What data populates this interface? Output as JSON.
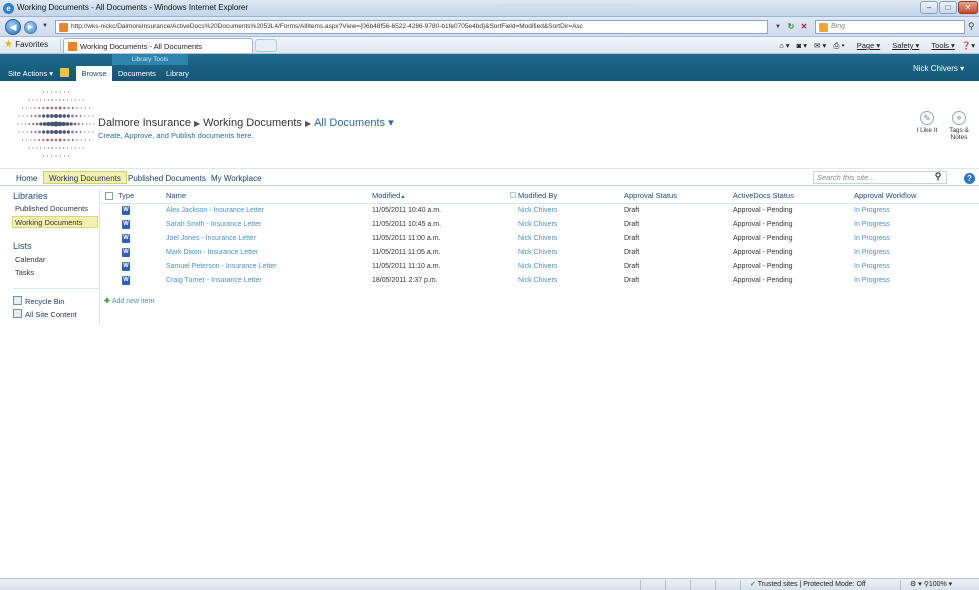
{
  "browser": {
    "window_title": "Working Documents - All Documents - Windows Internet Explorer",
    "url": "http://wks-nickc/DalmoreInsurance/ActiveDocs%20Documents%2053L4/Forms/AllItems.aspx?View={06b48f56-6522-4286-9780-b1fe0705e4bd}&SortField=Modified&SortDir=Asc",
    "search_placeholder": "Bing",
    "favorites_label": "Favorites",
    "tab_title": "Working Documents - All Documents",
    "commands": {
      "page": "Page",
      "safety": "Safety",
      "tools": "Tools"
    },
    "status_zone": "Trusted sites | Protected Mode: Off",
    "zoom": "100%"
  },
  "ribbon": {
    "tools_label": "Library Tools",
    "site_actions": "Site Actions",
    "tabs": {
      "browse": "Browse",
      "documents": "Documents",
      "library": "Library"
    },
    "user": "Nick Chivers"
  },
  "header": {
    "site": "Dalmore Insurance",
    "library": "Working Documents",
    "view": "All Documents",
    "description": "Create, Approve, and Publish documents here.",
    "i_like_it": "I Like It",
    "tags_notes_line1": "Tags &",
    "tags_notes_line2": "Notes"
  },
  "topnav": {
    "home": "Home",
    "working": "Working Documents",
    "published": "Published Documents",
    "workplace": "My Workplace",
    "search_placeholder": "Search this site..."
  },
  "quicklaunch": {
    "libraries_heading": "Libraries",
    "libraries": [
      "Published Documents",
      "Working Documents"
    ],
    "lists_heading": "Lists",
    "lists": [
      "Calendar",
      "Tasks"
    ],
    "recycle_bin": "Recycle Bin",
    "all_site_content": "All Site Content"
  },
  "doclist": {
    "columns": {
      "type": "Type",
      "name": "Name",
      "modified": "Modified",
      "modified_by": "Modified By",
      "approval_status": "Approval Status",
      "activedocs_status": "ActiveDocs Status",
      "approval_workflow": "Approval Workflow"
    },
    "rows": [
      {
        "name": "Alex Jackson - Insurance Letter",
        "modified": "11/05/2011 10:40 a.m.",
        "modified_by": "Nick Chivers",
        "approval": "Draft",
        "activedocs": "Approval - Pending",
        "workflow": "In Progress"
      },
      {
        "name": "Sarah Smith - Insurance Letter",
        "modified": "11/05/2011 10:45 a.m.",
        "modified_by": "Nick Chivers",
        "approval": "Draft",
        "activedocs": "Approval - Pending",
        "workflow": "In Progress"
      },
      {
        "name": "Joel Jones - Insurance Letter",
        "modified": "11/05/2011 11:00 a.m.",
        "modified_by": "Nick Chivers",
        "approval": "Draft",
        "activedocs": "Approval - Pending",
        "workflow": "In Progress"
      },
      {
        "name": "Mark Dixon - Insurance Letter",
        "modified": "11/05/2011 11:05 a.m.",
        "modified_by": "Nick Chivers",
        "approval": "Draft",
        "activedocs": "Approval - Pending",
        "workflow": "In Progress"
      },
      {
        "name": "Samuel Peterson - Insurance Letter",
        "modified": "11/05/2011 11:10 a.m.",
        "modified_by": "Nick Chivers",
        "approval": "Draft",
        "activedocs": "Approval - Pending",
        "workflow": "In Progress"
      },
      {
        "name": "Craig Turner - Insurance Letter",
        "modified": "18/05/2011 2:37 p.m.",
        "modified_by": "Nick Chivers",
        "approval": "Draft",
        "activedocs": "Approval - Pending",
        "workflow": "In Progress"
      }
    ],
    "add_new": "Add new item"
  },
  "colors": {
    "ribbon": "#1e6a8e",
    "link": "#4a90c8",
    "selected_nav": "#f6f0b0"
  }
}
